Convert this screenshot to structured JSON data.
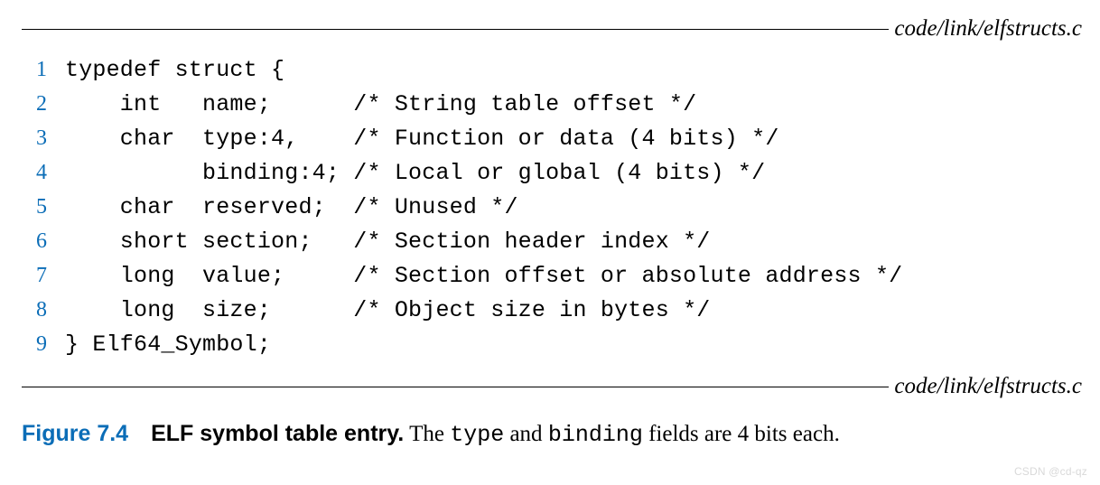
{
  "file_path": "code/link/elfstructs.c",
  "code": {
    "lines": [
      {
        "n": "1",
        "text": "typedef struct {"
      },
      {
        "n": "2",
        "text": "    int   name;      /* String table offset */"
      },
      {
        "n": "3",
        "text": "    char  type:4,    /* Function or data (4 bits) */"
      },
      {
        "n": "4",
        "text": "          binding:4; /* Local or global (4 bits) */"
      },
      {
        "n": "5",
        "text": "    char  reserved;  /* Unused */"
      },
      {
        "n": "6",
        "text": "    short section;   /* Section header index */"
      },
      {
        "n": "7",
        "text": "    long  value;     /* Section offset or absolute address */"
      },
      {
        "n": "8",
        "text": "    long  size;      /* Object size in bytes */"
      },
      {
        "n": "9",
        "text": "} Elf64_Symbol;"
      }
    ]
  },
  "caption": {
    "fig_num": "Figure 7.4",
    "title": "ELF symbol table entry.",
    "desc_pre": " The ",
    "code1": "type",
    "desc_mid": " and ",
    "code2": "binding",
    "desc_post": " fields are 4 bits each."
  },
  "watermark": "CSDN @cd-qz"
}
